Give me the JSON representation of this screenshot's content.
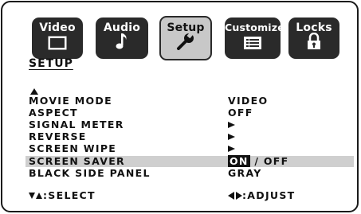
{
  "tabs": [
    {
      "label": "Video",
      "icon": "video-screen-icon",
      "active": false
    },
    {
      "label": "Audio",
      "icon": "music-note-icon",
      "active": false
    },
    {
      "label": "Setup",
      "icon": "wrench-icon",
      "active": true
    },
    {
      "label": "Customize",
      "icon": "list-icon",
      "active": false
    },
    {
      "label": "Locks",
      "icon": "padlock-icon",
      "active": false
    }
  ],
  "heading": "SETUP",
  "settings": [
    {
      "name": "MOVIE MODE",
      "value": "VIDEO"
    },
    {
      "name": "ASPECT",
      "value": "OFF"
    },
    {
      "name": "SIGNAL METER",
      "value": "",
      "value_icon": "right-arrow-icon"
    },
    {
      "name": "REVERSE",
      "value": "",
      "value_icon": "right-arrow-icon"
    },
    {
      "name": "SCREEN WIPE",
      "value": "",
      "value_icon": "right-arrow-icon"
    },
    {
      "name": "SCREEN SAVER",
      "value_on": "ON",
      "value_rest": "/ OFF",
      "highlighted": true
    },
    {
      "name": "BLACK SIDE PANEL",
      "value": "GRAY"
    }
  ],
  "footer": {
    "select": ":SELECT",
    "adjust": ":ADJUST"
  },
  "colors": {
    "tab_dark": "#2a2a2a",
    "tab_active": "#c8c8c8",
    "highlight": "#cfcfcf"
  }
}
